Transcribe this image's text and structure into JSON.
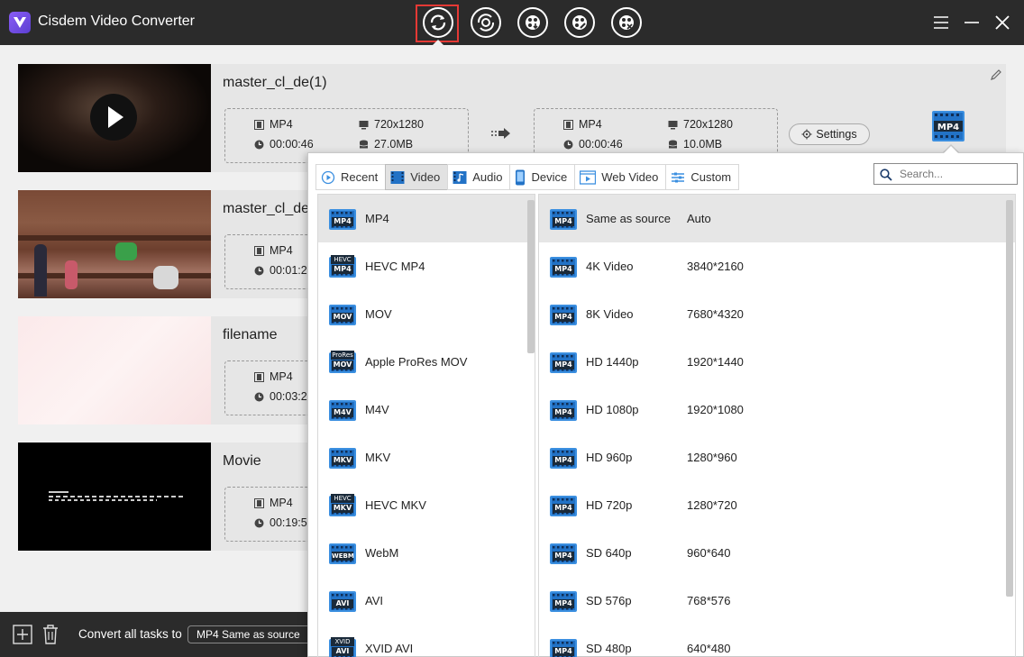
{
  "app": {
    "title": "Cisdem Video Converter"
  },
  "toolbar": {
    "icons": [
      "convert-icon",
      "rip-dvd-icon",
      "download-icon",
      "edit-video-icon",
      "compress-icon"
    ],
    "active_index": 0
  },
  "tasks": [
    {
      "name": "master_cl_de(1)",
      "source": {
        "format": "MP4",
        "resolution": "720x1280",
        "duration": "00:00:46",
        "size": "27.0MB"
      },
      "output": {
        "format": "MP4",
        "resolution": "720x1280",
        "duration": "00:00:46",
        "size": "10.0MB"
      },
      "settings_label": "Settings",
      "output_badge": "MP4"
    },
    {
      "name": "master_cl_de",
      "source": {
        "format": "MP4",
        "duration": "00:01:2"
      }
    },
    {
      "name": "filename",
      "source": {
        "format": "MP4",
        "duration": "00:03:2"
      }
    },
    {
      "name": "Movie",
      "source": {
        "format": "MP4",
        "duration": "00:19:5"
      }
    }
  ],
  "bottom": {
    "convert_all_label": "Convert all tasks to",
    "convert_all_value": "MP4 Same as source"
  },
  "popup": {
    "tabs": [
      {
        "label": "Recent",
        "icon": "clock-play-icon"
      },
      {
        "label": "Video",
        "icon": "film-icon",
        "active": true
      },
      {
        "label": "Audio",
        "icon": "audio-film-icon"
      },
      {
        "label": "Device",
        "icon": "phone-icon"
      },
      {
        "label": "Web Video",
        "icon": "web-video-icon"
      },
      {
        "label": "Custom",
        "icon": "sliders-icon"
      }
    ],
    "search_placeholder": "Search...",
    "formats": [
      {
        "label": "MP4",
        "badge": "MP4",
        "top": ""
      },
      {
        "label": "HEVC MP4",
        "badge": "MP4",
        "top": "HEVC"
      },
      {
        "label": "MOV",
        "badge": "MOV",
        "top": ""
      },
      {
        "label": "Apple ProRes MOV",
        "badge": "MOV",
        "top": "ProRes"
      },
      {
        "label": "M4V",
        "badge": "M4V",
        "top": ""
      },
      {
        "label": "MKV",
        "badge": "MKV",
        "top": ""
      },
      {
        "label": "HEVC MKV",
        "badge": "MKV",
        "top": "HEVC"
      },
      {
        "label": "WebM",
        "badge": "WEBM",
        "top": ""
      },
      {
        "label": "AVI",
        "badge": "AVI",
        "top": ""
      },
      {
        "label": "XVID AVI",
        "badge": "AVI",
        "top": "XVID"
      }
    ],
    "presets": [
      {
        "name": "Same as source",
        "value": "Auto"
      },
      {
        "name": "4K Video",
        "value": "3840*2160"
      },
      {
        "name": "8K Video",
        "value": "7680*4320"
      },
      {
        "name": "HD 1440p",
        "value": "1920*1440"
      },
      {
        "name": "HD 1080p",
        "value": "1920*1080"
      },
      {
        "name": "HD 960p",
        "value": "1280*960"
      },
      {
        "name": "HD 720p",
        "value": "1280*720"
      },
      {
        "name": "SD 640p",
        "value": "960*640"
      },
      {
        "name": "SD 576p",
        "value": "768*576"
      },
      {
        "name": "SD 480p",
        "value": "640*480"
      }
    ],
    "preset_badge": "MP4"
  },
  "colors": {
    "titlebar": "#2b2b2b",
    "active_frame": "#e53935",
    "badge_blue": "#3b8fe0"
  }
}
